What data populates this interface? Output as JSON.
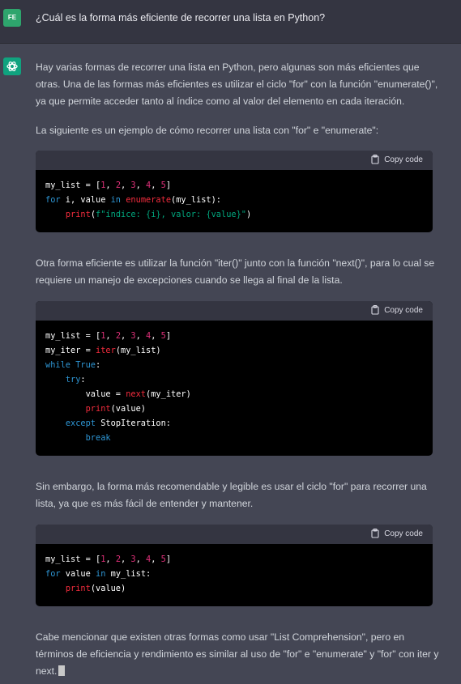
{
  "user": {
    "avatar": "FE",
    "question": "¿Cuál es la forma más eficiente de recorrer una lista en Python?"
  },
  "assistant": {
    "avatar_icon": "openai-logo-icon",
    "para1": "Hay varias formas de recorrer una lista en Python, pero algunas son más eficientes que otras. Una de las formas más eficientes es utilizar el ciclo \"for\" con la función \"enumerate()\", ya que permite acceder tanto al índice como al valor del elemento en cada iteración.",
    "para2": "La siguiente es un ejemplo de cómo recorrer una lista con \"for\" e \"enumerate\":",
    "para3": "Otra forma eficiente es utilizar la función \"iter()\" junto con la función \"next()\", para lo cual se requiere un manejo de excepciones cuando se llega al final de la lista.",
    "para4": "Sin embargo, la forma más recomendable y legible es usar el ciclo \"for\" para recorrer una lista, ya que es más fácil de entender y mantener.",
    "para5": "Cabe mencionar que existen otras formas como usar \"List Comprehension\", pero en términos de eficiencia y rendimiento es similar al uso de \"for\" e \"enumerate\" y \"for\" con iter y next."
  },
  "copy_label": "Copy code",
  "code_blocks": [
    {
      "lines": [
        "my_list = [1, 2, 3, 4, 5]",
        "for i, value in enumerate(my_list):",
        "    print(f\"índice: {i}, valor: {value}\")"
      ]
    },
    {
      "lines": [
        "my_list = [1, 2, 3, 4, 5]",
        "my_iter = iter(my_list)",
        "while True:",
        "    try:",
        "        value = next(my_iter)",
        "        print(value)",
        "    except StopIteration:",
        "        break"
      ]
    },
    {
      "lines": [
        "my_list = [1, 2, 3, 4, 5]",
        "for value in my_list:",
        "    print(value)"
      ]
    }
  ],
  "colors": {
    "keyword": "#2e95d3",
    "number": "#df3079",
    "function": "#f22c3d",
    "string": "#00a67d"
  }
}
